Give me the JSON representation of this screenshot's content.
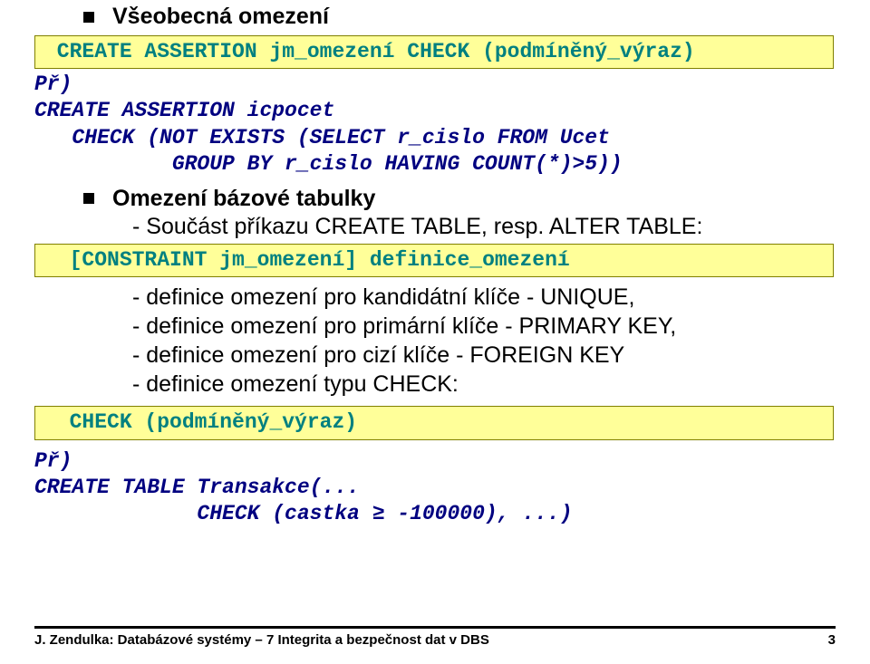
{
  "section1": {
    "title": "Všeobecná omezení",
    "codebox": " CREATE ASSERTION jm_omezení CHECK (podmíněný_výraz)",
    "pr_label": "Př)",
    "example": "CREATE ASSERTION icpocet\n   CHECK (NOT EXISTS (SELECT r_cislo FROM Ucet\n           GROUP BY r_cislo HAVING COUNT(*)>5))"
  },
  "section2": {
    "title": "Omezení bázové tabulky",
    "dash_line": "-  Součást příkazu CREATE TABLE, resp. ALTER TABLE:",
    "codebox": "  [CONSTRAINT jm_omezení] definice_omezení",
    "definitions": "- definice omezení pro kandidátní klíče - UNIQUE,\n- definice omezení pro primární klíče - PRIMARY KEY,\n- definice omezení pro cizí klíče - FOREIGN KEY\n- definice omezení typu CHECK:",
    "codebox2": "  CHECK (podmíněný_výraz)",
    "pr_label": "Př)",
    "example": "CREATE TABLE Transakce(...\n             CHECK (castka ≥ -100000), ...)"
  },
  "footer": {
    "left": "J. Zendulka: Databázové systémy – 7 Integrita a bezpečnost dat v DBS",
    "right": "3"
  }
}
